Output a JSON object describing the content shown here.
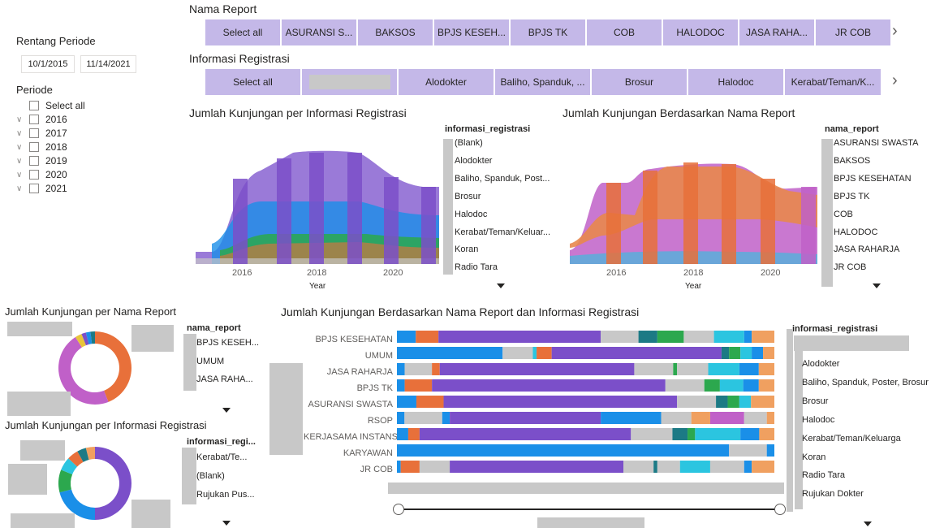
{
  "nama_report_slicer": {
    "title": "Nama Report",
    "buttons": [
      "Select all",
      "ASURANSI S...",
      "BAKSOS",
      "BPJS KESEH...",
      "BPJS TK",
      "COB",
      "HALODOC",
      "JASA RAHA...",
      "JR COB"
    ]
  },
  "info_registrasi_slicer": {
    "title": "Informasi Registrasi",
    "buttons": [
      "Select all",
      "",
      "Alodokter",
      "Baliho, Spanduk, ...",
      "Brosur",
      "Halodoc",
      "Kerabat/Teman/K..."
    ]
  },
  "rentang_periode": {
    "title": "Rentang Periode",
    "start": "10/1/2015",
    "end": "11/14/2021"
  },
  "periode": {
    "title": "Periode",
    "select_all": "Select all",
    "years": [
      "2016",
      "2017",
      "2018",
      "2019",
      "2020",
      "2021"
    ]
  },
  "ribbon_left": {
    "title": "Jumlah Kunjungan per Informasi Registrasi",
    "legend_title": "informasi_registrasi",
    "legend": [
      "(Blank)",
      "Alodokter",
      "Baliho, Spanduk, Post...",
      "Brosur",
      "Halodoc",
      "Kerabat/Teman/Keluar...",
      "Koran",
      "Radio Tara"
    ],
    "x_ticks": [
      "2016",
      "2018",
      "2020"
    ],
    "x_label": "Year"
  },
  "ribbon_right": {
    "title": "Jumlah Kunjungan Berdasarkan Nama Report",
    "legend_title": "nama_report",
    "legend": [
      "ASURANSI SWASTA",
      "BAKSOS",
      "BPJS KESEHATAN",
      "BPJS TK",
      "COB",
      "HALODOC",
      "JASA RAHARJA",
      "JR COB"
    ],
    "x_ticks": [
      "2016",
      "2018",
      "2020"
    ],
    "x_label": "Year"
  },
  "donut_top": {
    "title": "Jumlah Kunjungan per Nama Report",
    "legend_title": "nama_report",
    "legend": [
      "BPJS KESEH...",
      "UMUM",
      "JASA RAHA..."
    ]
  },
  "donut_bottom": {
    "title": "Jumlah Kunjungan per Informasi Registrasi",
    "legend_title": "informasi_regi...",
    "legend": [
      "Kerabat/Te...",
      "(Blank)",
      "Rujukan Pus..."
    ]
  },
  "stacked_bar": {
    "title": "Jumlah Kunjungan Berdasarkan Nama Report dan Informasi Registrasi",
    "legend_title": "informasi_registrasi",
    "legend": [
      "Alodokter",
      "Baliho, Spanduk, Poster, Brosur",
      "Brosur",
      "Halodoc",
      "Kerabat/Teman/Keluarga",
      "Koran",
      "Radio Tara",
      "Rujukan Dokter"
    ]
  },
  "chart_data": [
    {
      "type": "area",
      "title": "Jumlah Kunjungan per Informasi Registrasi",
      "xlabel": "Year",
      "x_ticks": [
        "2016",
        "2018",
        "2020"
      ]
    },
    {
      "type": "area",
      "title": "Jumlah Kunjungan Berdasarkan Nama Report",
      "xlabel": "Year",
      "x_ticks": [
        "2016",
        "2018",
        "2020"
      ]
    },
    {
      "type": "pie",
      "title": "Jumlah Kunjungan per Nama Report",
      "categories": [
        "BPJS KESEH...",
        "UMUM",
        "JASA RAHA..."
      ],
      "values": [
        44,
        50,
        6
      ]
    },
    {
      "type": "pie",
      "title": "Jumlah Kunjungan per Informasi Registrasi",
      "categories": [
        "Kerabat/Te...",
        "(Blank)",
        "Rujukan Pus..."
      ],
      "values": [
        50,
        21,
        29
      ]
    },
    {
      "type": "bar",
      "title": "Jumlah Kunjungan Berdasarkan Nama Report dan Informasi Registrasi",
      "categories": [
        "BPJS KESEHATAN",
        "UMUM",
        "JASA RAHARJA",
        "BPJS TK",
        "ASURANSI SWASTA",
        "RSOP",
        "KERJASAMA INSTANSI",
        "KARYAWAN",
        "JR COB"
      ],
      "stacked_percent": true
    }
  ],
  "colors": {
    "slicer": "#c4b8e8",
    "purple": "#7b4fc9",
    "blue": "#1a8fe8",
    "orange": "#e8703a",
    "green": "#2ca84e",
    "teal": "#1c7a85",
    "cyan": "#2bc5e0",
    "pink": "#c060c8",
    "gray": "#c8c8c8"
  }
}
